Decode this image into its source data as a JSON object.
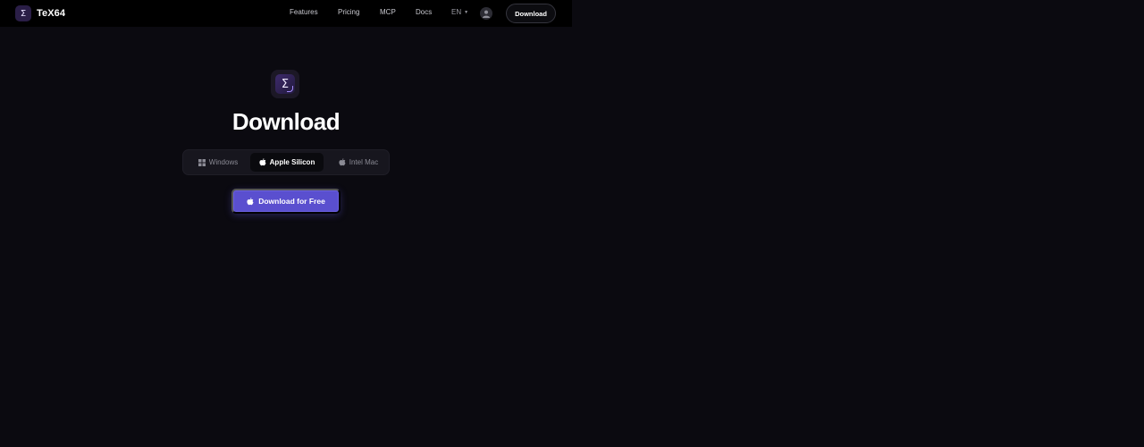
{
  "header": {
    "brand": {
      "logo_glyph": "Σ",
      "name": "TeX64"
    },
    "nav": [
      {
        "label": "Features"
      },
      {
        "label": "Pricing"
      },
      {
        "label": "MCP"
      },
      {
        "label": "Docs"
      }
    ],
    "language": {
      "label": "EN",
      "caret": "▼"
    },
    "avatar_icon": "user-icon",
    "download_label": "Download"
  },
  "main": {
    "logo_glyph": "Σ",
    "title": "Download",
    "tabs": [
      {
        "label": "Windows",
        "icon": "windows-icon",
        "selected": false
      },
      {
        "label": "Apple Silicon",
        "icon": "apple-icon",
        "selected": true
      },
      {
        "label": "Intel Mac",
        "icon": "apple-icon",
        "selected": false
      }
    ],
    "cta": {
      "label": "Download for Free",
      "icon": "apple-icon"
    }
  },
  "colors": {
    "background": "#0b0a10",
    "header": "#000000",
    "accent": "#5a4fcf",
    "brand_logo": "#2a1e47"
  }
}
